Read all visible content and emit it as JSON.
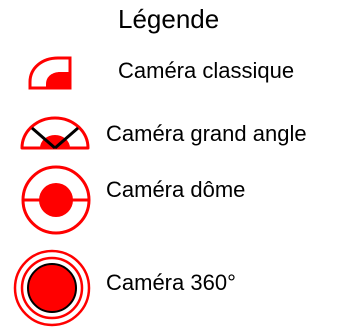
{
  "legend": {
    "title": "Légende",
    "items": [
      {
        "label": "Caméra classique",
        "icon": "classic-camera-icon"
      },
      {
        "label": "Caméra grand angle",
        "icon": "wide-angle-camera-icon"
      },
      {
        "label": "Caméra dôme",
        "icon": "dome-camera-icon"
      },
      {
        "label": "Caméra 360°",
        "icon": "camera-360-icon"
      }
    ]
  },
  "colors": {
    "accent": "#ff0000",
    "text": "#000000",
    "background": "#ffffff"
  }
}
